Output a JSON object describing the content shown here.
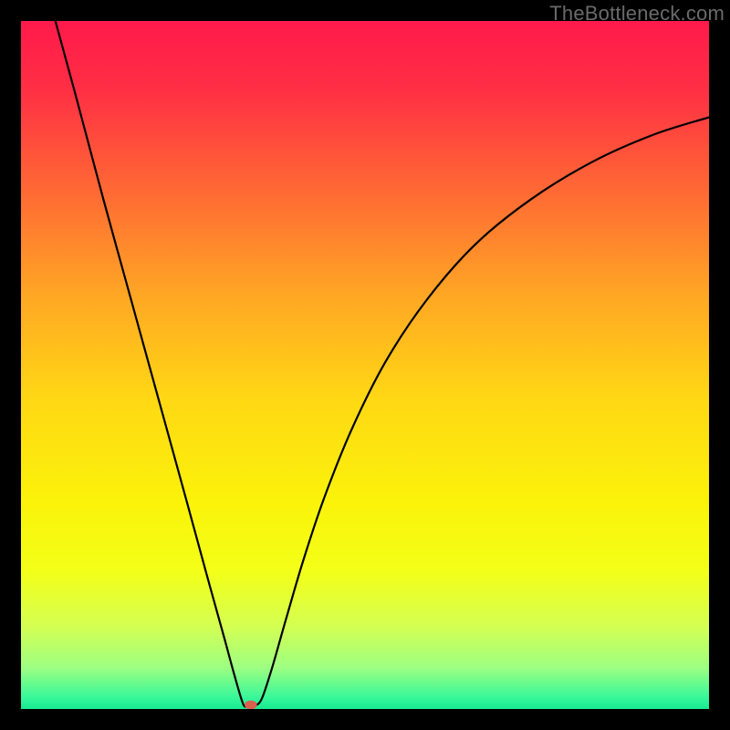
{
  "watermark": "TheBottleneck.com",
  "chart_data": {
    "type": "line",
    "title": "",
    "xlabel": "",
    "ylabel": "",
    "xlim": [
      0,
      100
    ],
    "ylim": [
      0,
      100
    ],
    "grid": false,
    "background_gradient": {
      "stops": [
        {
          "offset": 0.0,
          "color": "#ff1a4b"
        },
        {
          "offset": 0.1,
          "color": "#ff2f44"
        },
        {
          "offset": 0.25,
          "color": "#ff6a34"
        },
        {
          "offset": 0.4,
          "color": "#ffa724"
        },
        {
          "offset": 0.55,
          "color": "#ffd814"
        },
        {
          "offset": 0.7,
          "color": "#fbf30a"
        },
        {
          "offset": 0.8,
          "color": "#f3ff18"
        },
        {
          "offset": 0.88,
          "color": "#d4ff52"
        },
        {
          "offset": 0.94,
          "color": "#9dff82"
        },
        {
          "offset": 0.985,
          "color": "#34f79a"
        },
        {
          "offset": 1.0,
          "color": "#18e98f"
        }
      ]
    },
    "series": [
      {
        "name": "curve",
        "stroke": "#000000",
        "stroke_width": 2.2,
        "points": [
          {
            "x": 5.0,
            "y": 100.0
          },
          {
            "x": 8.0,
            "y": 89.0
          },
          {
            "x": 12.0,
            "y": 74.0
          },
          {
            "x": 16.0,
            "y": 59.5
          },
          {
            "x": 20.0,
            "y": 45.0
          },
          {
            "x": 24.0,
            "y": 30.5
          },
          {
            "x": 27.0,
            "y": 19.5
          },
          {
            "x": 29.5,
            "y": 10.5
          },
          {
            "x": 31.0,
            "y": 5.0
          },
          {
            "x": 32.3,
            "y": 0.7
          },
          {
            "x": 33.0,
            "y": 0.5
          },
          {
            "x": 34.0,
            "y": 0.5
          },
          {
            "x": 35.0,
            "y": 1.5
          },
          {
            "x": 36.5,
            "y": 6.0
          },
          {
            "x": 38.5,
            "y": 13.0
          },
          {
            "x": 41.0,
            "y": 21.5
          },
          {
            "x": 44.0,
            "y": 30.5
          },
          {
            "x": 48.0,
            "y": 40.5
          },
          {
            "x": 53.0,
            "y": 50.5
          },
          {
            "x": 59.0,
            "y": 59.5
          },
          {
            "x": 66.0,
            "y": 67.5
          },
          {
            "x": 74.0,
            "y": 74.0
          },
          {
            "x": 83.0,
            "y": 79.5
          },
          {
            "x": 92.0,
            "y": 83.5
          },
          {
            "x": 100.0,
            "y": 86.0
          }
        ]
      }
    ],
    "marker": {
      "name": "min-point",
      "x": 33.4,
      "y": 0.6,
      "rx": 0.9,
      "ry": 0.65,
      "fill": "#d9604f"
    }
  }
}
